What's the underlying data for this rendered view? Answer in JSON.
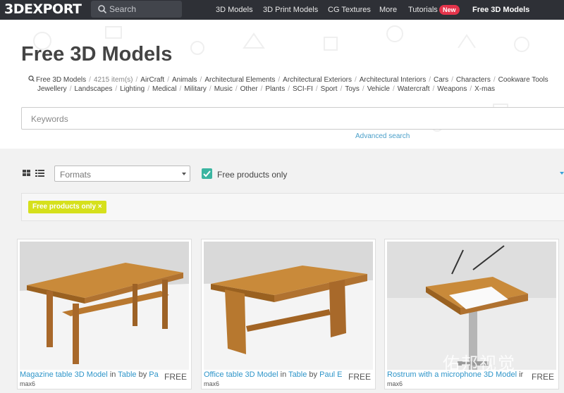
{
  "header": {
    "logo": "3DEXPORT",
    "search_placeholder": "Search",
    "nav": [
      {
        "label": "3D Models"
      },
      {
        "label": "3D Print Models"
      },
      {
        "label": "CG Textures"
      },
      {
        "label": "More"
      },
      {
        "label": "Tutorials"
      },
      {
        "label": "Free 3D Models"
      }
    ],
    "tutorials_badge": "New"
  },
  "page": {
    "title": "Free 3D Models",
    "breadcrumb_root": "Free 3D Models",
    "item_count": "4215 item(s)",
    "categories_row1": [
      "AirCraft",
      "Animals",
      "Architectural Elements",
      "Architectural Exteriors",
      "Architectural Interiors",
      "Cars",
      "Characters",
      "Cookware Tools"
    ],
    "categories_row2": [
      "Jewellery",
      "Landscapes",
      "Lighting",
      "Medical",
      "Military",
      "Music",
      "Other",
      "Plants",
      "SCI-FI",
      "Sport",
      "Toys",
      "Vehicle",
      "Watercraft",
      "Weapons",
      "X-mas"
    ]
  },
  "search": {
    "keywords_placeholder": "Keywords",
    "advanced_label": "Advanced search"
  },
  "filters": {
    "formats_label": "Formats",
    "free_only_label": "Free products only",
    "free_only_checked": true,
    "active_chip": "Free products only ×"
  },
  "products": [
    {
      "name": "Magazine table 3D Model",
      "in": "in",
      "category": "Table",
      "by": "by",
      "author": "Pa",
      "format": "max6",
      "price": "FREE"
    },
    {
      "name": "Office table 3D Model",
      "in": "in",
      "category": "Table",
      "by": "by",
      "author": "Paul E",
      "format": "max6",
      "price": "FREE"
    },
    {
      "name": "Rostrum with a microphone 3D Model",
      "in": "in",
      "category": "",
      "by": "",
      "author": "",
      "format": "max6",
      "price": "FREE"
    }
  ],
  "watermark": "佑邦视觉",
  "colors": {
    "accent": "#2e95c9",
    "checkbox": "#3bb5a1",
    "chip": "#d6e01c",
    "badge": "#e4344b",
    "topbar": "#2e3036"
  }
}
